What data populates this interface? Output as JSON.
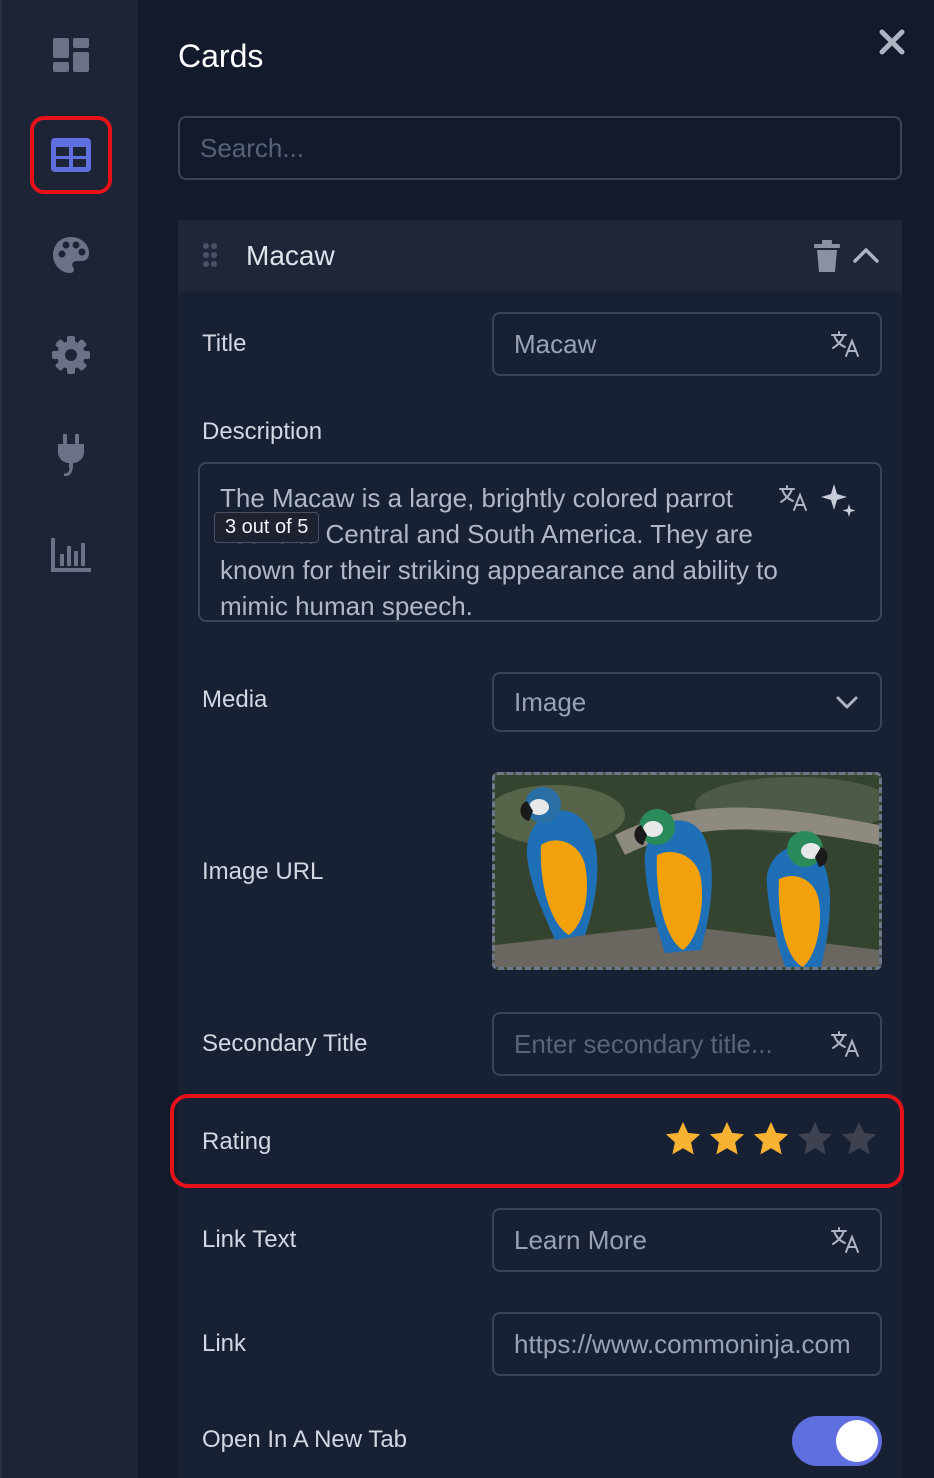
{
  "panel": {
    "title": "Cards",
    "search_placeholder": "Search..."
  },
  "rail": {
    "items": [
      {
        "icon": "dashboard-icon"
      },
      {
        "icon": "table-grid-icon",
        "selected": true
      },
      {
        "icon": "palette-icon"
      },
      {
        "icon": "gear-icon"
      },
      {
        "icon": "plug-icon"
      },
      {
        "icon": "bar-chart-icon"
      }
    ]
  },
  "card": {
    "name": "Macaw",
    "fields": {
      "title_label": "Title",
      "title_value": "Macaw",
      "description_label": "Description",
      "description_value": "The Macaw is a large, brightly colored parrot native to Central and South America. They are known for their striking appearance and ability to mimic human speech.",
      "media_label": "Media",
      "media_value": "Image",
      "image_url_label": "Image URL",
      "secondary_title_label": "Secondary Title",
      "secondary_title_placeholder": "Enter secondary title...",
      "rating_label": "Rating",
      "rating_value": 3,
      "rating_max": 5,
      "link_text_label": "Link Text",
      "link_text_value": "Learn More",
      "link_label": "Link",
      "link_value": "https://www.commoninja.com",
      "new_tab_label": "Open In A New Tab",
      "new_tab_enabled": true
    }
  },
  "tooltip": "3 out of 5",
  "colors": {
    "accent": "#5f6fe0",
    "highlight": "#e5121a",
    "star_filled": "#f8b232",
    "star_empty": "#3d4150"
  }
}
